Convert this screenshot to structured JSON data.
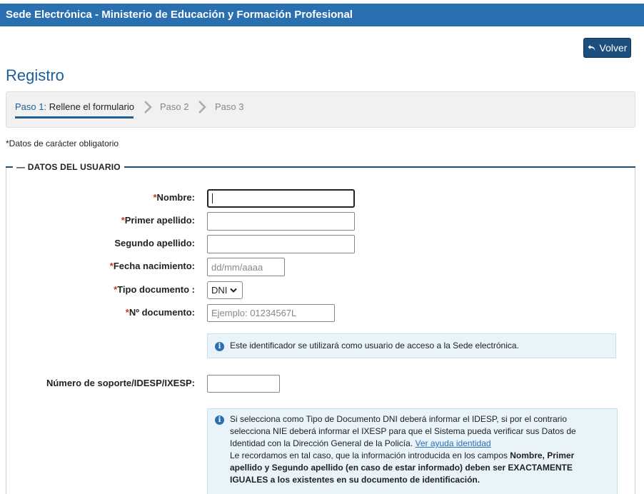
{
  "header": {
    "title": "Sede Electrónica - Ministerio de Educación y Formación Profesional"
  },
  "toolbar": {
    "back_label": "Volver"
  },
  "page": {
    "title": "Registro"
  },
  "steps": [
    {
      "num": "Paso 1:",
      "label": "Rellene el formulario"
    },
    {
      "label": "Paso 2"
    },
    {
      "label": "Paso 3"
    }
  ],
  "form": {
    "mandatory_note": "*Datos de carácter obligatorio",
    "legend": "DATOS DEL USUARIO",
    "required_mark": "*",
    "fields": {
      "nombre": {
        "label": "Nombre:",
        "value": ""
      },
      "primer_apellido": {
        "label": "Primer apellido:",
        "value": ""
      },
      "segundo_apellido": {
        "label": "Segundo apellido:",
        "value": ""
      },
      "fecha_nacimiento": {
        "label": "Fecha nacimiento:",
        "placeholder": "dd/mm/aaaa"
      },
      "tipo_documento": {
        "label": "Tipo documento :",
        "selected": "DNI"
      },
      "num_documento": {
        "label": "Nº documento:",
        "placeholder": "Ejemplo: 01234567L"
      },
      "num_soporte": {
        "label": "Número de soporte/IDESP/IXESP:",
        "value": ""
      }
    },
    "info1": "Este identificador se utilizará como usuario de acceso a la Sede electrónica.",
    "info2": {
      "text1": "Si selecciona como Tipo de Documento DNI deberá informar el IDESP, si por el contrario selecciona NIE deberá informar el IXESP para que el Sistema pueda verificar sus Datos de Identidad con la Dirección General de la Policía. ",
      "link": "Ver ayuda identidad",
      "text2": "Le recordamos en tal caso, que la información introducida en los campos ",
      "bold": "Nombre, Primer apellido y Segundo apellido (en caso de estar informado) deben ser EXACTAMENTE IGUALES a los existentes en su documento de identificación."
    }
  },
  "colors": {
    "header": "#2a6fb0",
    "accent": "#1c5f99",
    "button": "#1c4f7d",
    "info_bg": "#e8f4fa"
  }
}
